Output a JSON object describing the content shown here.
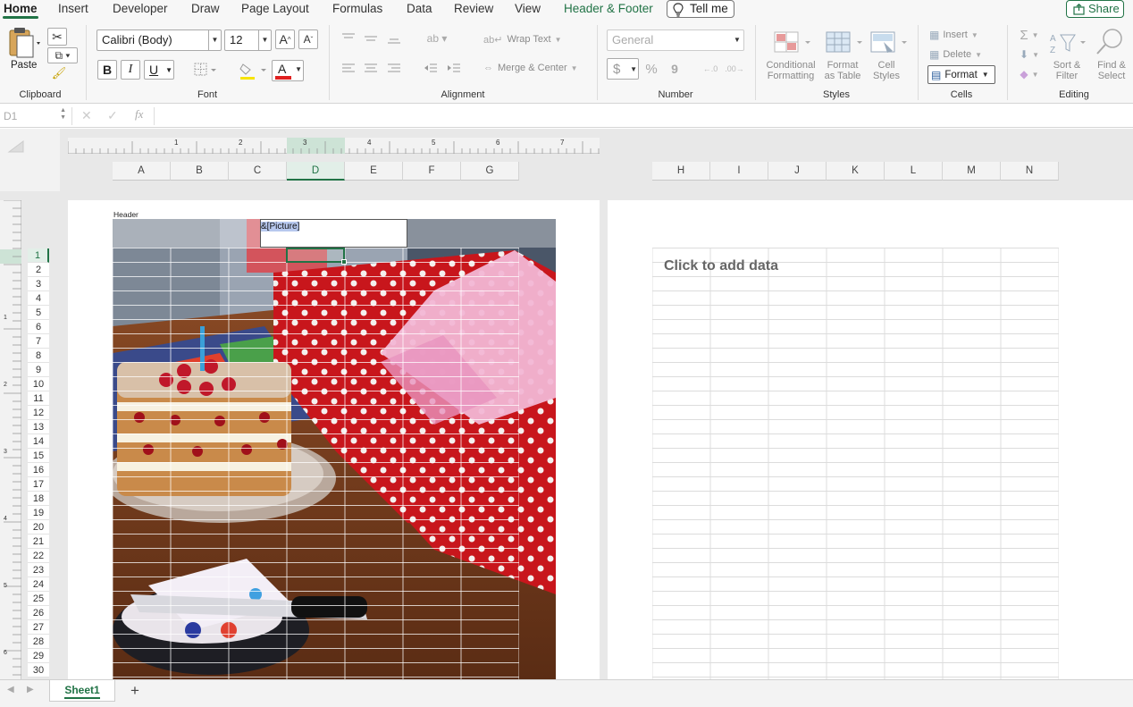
{
  "tabs": [
    "Home",
    "Insert",
    "Developer",
    "Draw",
    "Page Layout",
    "Formulas",
    "Data",
    "Review",
    "View",
    "Header & Footer"
  ],
  "tell_me": "Tell me",
  "share": "Share",
  "clipboard": {
    "paste_label": "Paste",
    "group_label": "Clipboard"
  },
  "font": {
    "name": "Calibri (Body)",
    "size": "12",
    "bold": "B",
    "italic": "I",
    "underline": "U",
    "color_letter": "A",
    "grow": "A",
    "shrink": "A",
    "group_label": "Font"
  },
  "alignment": {
    "wrap_text": "Wrap Text",
    "merge_center": "Merge & Center",
    "group_label": "Alignment"
  },
  "number": {
    "format": "General",
    "currency": "$",
    "percent": "%",
    "comma": "9",
    "group_label": "Number"
  },
  "styles": {
    "conditional_line1": "Conditional",
    "conditional_line2": "Formatting",
    "table_line1": "Format",
    "table_line2": "as Table",
    "cell_line1": "Cell",
    "cell_line2": "Styles",
    "group_label": "Styles"
  },
  "cells": {
    "insert": "Insert",
    "delete": "Delete",
    "format": "Format",
    "group_label": "Cells"
  },
  "editing": {
    "sort_line1": "Sort &",
    "sort_line2": "Filter",
    "find_line1": "Find &",
    "find_line2": "Select",
    "sigma": "Σ",
    "group_label": "Editing"
  },
  "formula_bar": {
    "name_box": "D1",
    "fx": "fx",
    "cancel": "✕",
    "enter": "✓",
    "content": ""
  },
  "ruler_numbers": [
    "1",
    "2",
    "3",
    "4",
    "5",
    "6",
    "7"
  ],
  "vruler_numbers": [
    "1",
    "2",
    "3",
    "4",
    "5",
    "6"
  ],
  "columns_left": [
    "A",
    "B",
    "C",
    "D",
    "E",
    "F",
    "G"
  ],
  "columns_right": [
    "H",
    "I",
    "J",
    "K",
    "L",
    "M",
    "N"
  ],
  "rows": [
    "1",
    "2",
    "3",
    "4",
    "5",
    "6",
    "7",
    "8",
    "9",
    "10",
    "11",
    "12",
    "13",
    "14",
    "15",
    "16",
    "17",
    "18",
    "19",
    "20",
    "21",
    "22",
    "23",
    "24",
    "25",
    "26",
    "27",
    "28",
    "29",
    "30"
  ],
  "selected_column": "D",
  "selected_row": "1",
  "header": {
    "label": "Header",
    "field_code": "&[Picture]"
  },
  "page2": {
    "placeholder": "Click to add data"
  },
  "sheets": [
    {
      "name": "Sheet1",
      "active": true
    }
  ],
  "add_sheet": "+",
  "colors": {
    "accent": "#217346",
    "selection_fill": "#e2efe8",
    "ribbon_bg": "#f7f7f7",
    "font_color_bar": "#e02020",
    "highlight_bar": "#f7e400"
  }
}
